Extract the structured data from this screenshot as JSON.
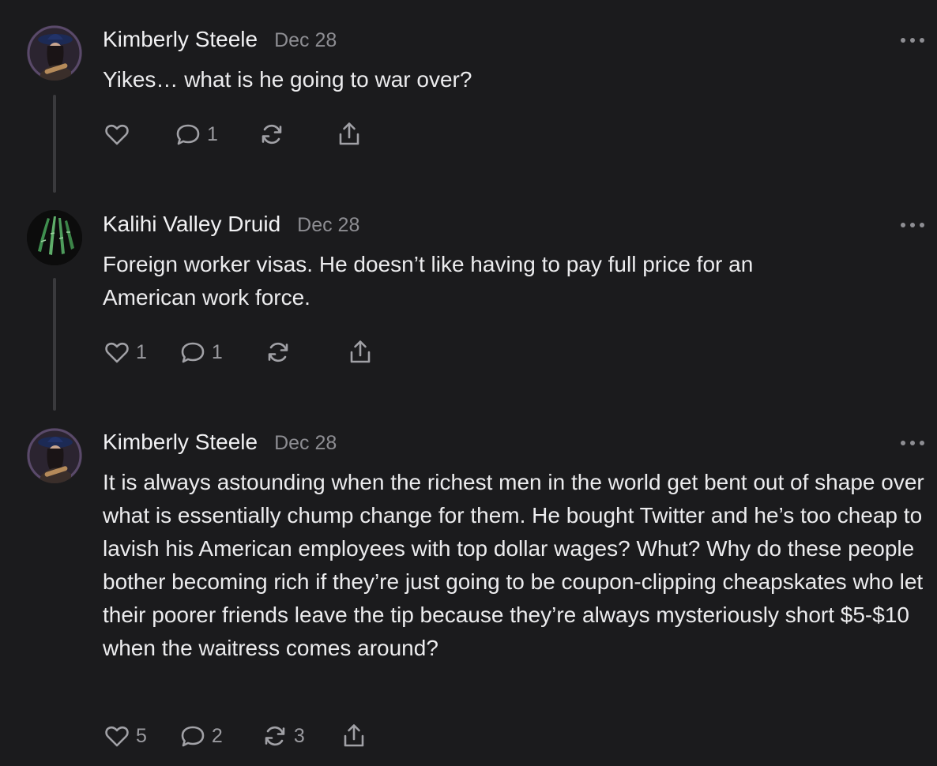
{
  "comments": [
    {
      "author": "Kimberly Steele",
      "date": "Dec 28",
      "text": "Yikes… what is he going to war over?",
      "likes": "",
      "replies": "1",
      "restacks": ""
    },
    {
      "author": "Kalihi Valley Druid",
      "date": "Dec 28",
      "text": "Foreign worker visas. He doesn’t like having to pay full price for an American work force.",
      "likes": "1",
      "replies": "1",
      "restacks": ""
    },
    {
      "author": "Kimberly Steele",
      "date": "Dec 28",
      "text": "It is always astounding when the richest men in the world get bent out of shape over what is essentially chump change for them. He bought Twitter and he’s too cheap to lavish his American employees with top dollar wages? Whut? Why do these people bother becoming rich if they’re just going to be coupon-clipping cheapskates who let their poorer friends leave the tip because they’re always mysteriously short $5-$10 when the waitress comes around?",
      "likes": "5",
      "replies": "2",
      "restacks": "3"
    }
  ],
  "icons": {
    "like": "heart-icon",
    "reply": "comment-bubble-icon",
    "restack": "restack-arrows-icon",
    "share": "share-upload-icon",
    "more": "more-options-icon"
  },
  "colors": {
    "background": "#1b1b1d",
    "text": "#ececee",
    "muted": "#8d8d92",
    "icon": "#a1a1a6",
    "thread_line": "#3a3a3d"
  }
}
